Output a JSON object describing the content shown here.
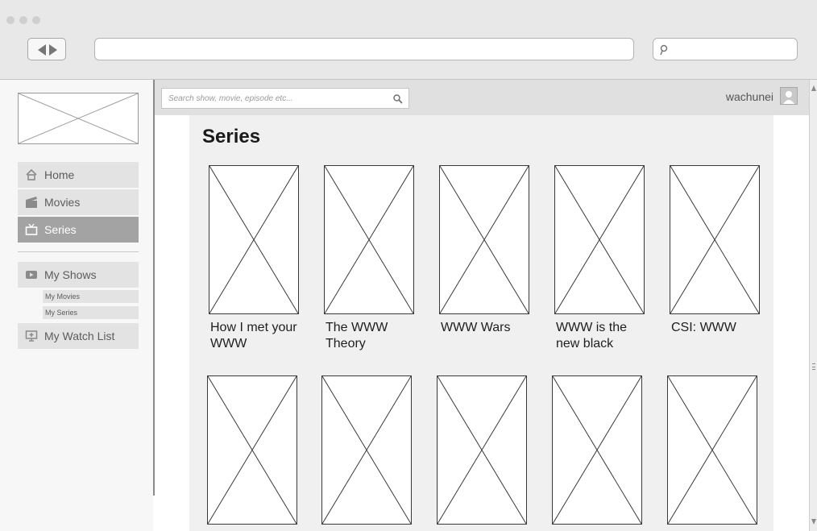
{
  "browser": {
    "url": "",
    "search_value": "",
    "icons": [
      "back-arrow-icon",
      "forward-arrow-icon",
      "search-icon"
    ]
  },
  "app": {
    "search": {
      "placeholder": "Search show, movie, episode etc...",
      "value": ""
    },
    "user": {
      "name": "wachunei",
      "avatar_icon": "user-avatar-icon"
    }
  },
  "sidebar": {
    "logo": "logo-placeholder",
    "nav": [
      {
        "label": "Home",
        "icon": "home-icon",
        "active": false
      },
      {
        "label": "Movies",
        "icon": "film-icon",
        "active": false
      },
      {
        "label": "Series",
        "icon": "tv-icon",
        "active": true
      }
    ],
    "my_shows": {
      "label": "My Shows",
      "icon": "play-icon"
    },
    "sub_items": [
      {
        "label": "My Movies"
      },
      {
        "label": "My Series"
      }
    ],
    "watch_list": {
      "label": "My Watch List",
      "icon": "monitor-plus-icon"
    }
  },
  "page": {
    "title": "Series"
  },
  "series": [
    {
      "title": "How I met your WWW"
    },
    {
      "title": "The WWW Theory"
    },
    {
      "title": "WWW Wars"
    },
    {
      "title": "WWW is the new black"
    },
    {
      "title": "CSI: WWW"
    },
    {
      "title": ""
    },
    {
      "title": ""
    },
    {
      "title": ""
    },
    {
      "title": ""
    },
    {
      "title": ""
    }
  ],
  "colors": {
    "active_nav": "#a3a3a3",
    "nav_bg": "#e3e3e3",
    "chrome_bg": "#e8e8e8",
    "content_bg": "#f0f0f0"
  }
}
